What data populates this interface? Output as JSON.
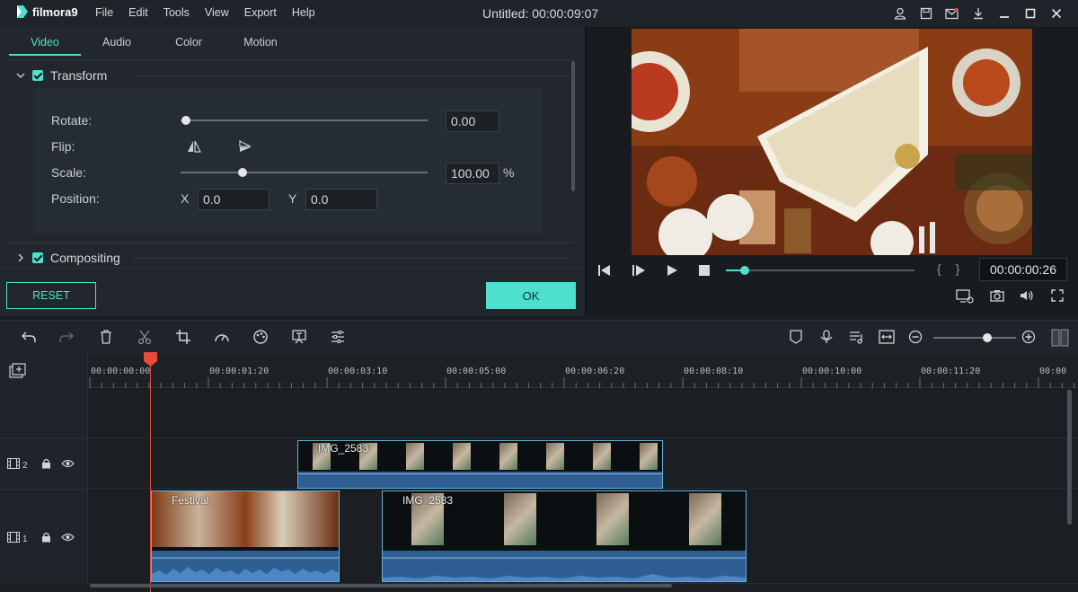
{
  "titlebar": {
    "app_name": "filmora9",
    "menu": [
      "File",
      "Edit",
      "Tools",
      "View",
      "Export",
      "Help"
    ],
    "title": "Untitled:",
    "title_time": "00:00:09:07",
    "icons": [
      "account-icon",
      "save-icon",
      "mail-icon",
      "download-icon",
      "minimize-icon",
      "maximize-icon",
      "close-icon"
    ]
  },
  "editor": {
    "tabs": [
      "Video",
      "Audio",
      "Color",
      "Motion"
    ],
    "active_tab": "Video",
    "transform": {
      "label": "Transform",
      "rotate_label": "Rotate:",
      "rotate_value": "0.00",
      "rotate_fraction": 0.0,
      "flip_label": "Flip:",
      "scale_label": "Scale:",
      "scale_value": "100.00",
      "scale_unit": "%",
      "scale_fraction": 0.25,
      "position_label": "Position:",
      "x_label": "X",
      "x_value": "0.0",
      "y_label": "Y",
      "y_value": "0.0"
    },
    "compositing": {
      "label": "Compositing"
    },
    "reset_label": "RESET",
    "ok_label": "OK"
  },
  "preview": {
    "timecode": "00:00:00:26",
    "progress_fraction": 0.1,
    "brackets": "{ }"
  },
  "timeline": {
    "ruler_labels": [
      "00:00:00:00",
      "00:00:01:20",
      "00:00:03:10",
      "00:00:05:00",
      "00:00:06:20",
      "00:00:08:10",
      "00:00:10:00",
      "00:00:11:20",
      "00:00"
    ],
    "tracks": [
      {
        "number": "2",
        "clips": [
          {
            "name": "IMG_2583"
          }
        ]
      },
      {
        "number": "1",
        "clips": [
          {
            "name": "Festival"
          },
          {
            "name": "IMG_2583"
          }
        ]
      }
    ],
    "zoom_fraction": 0.6
  },
  "colors": {
    "accent": "#4ee0cf",
    "playhead": "#e54c3c",
    "clip_border": "#5fb0d8",
    "audio": "#2f5e93"
  }
}
